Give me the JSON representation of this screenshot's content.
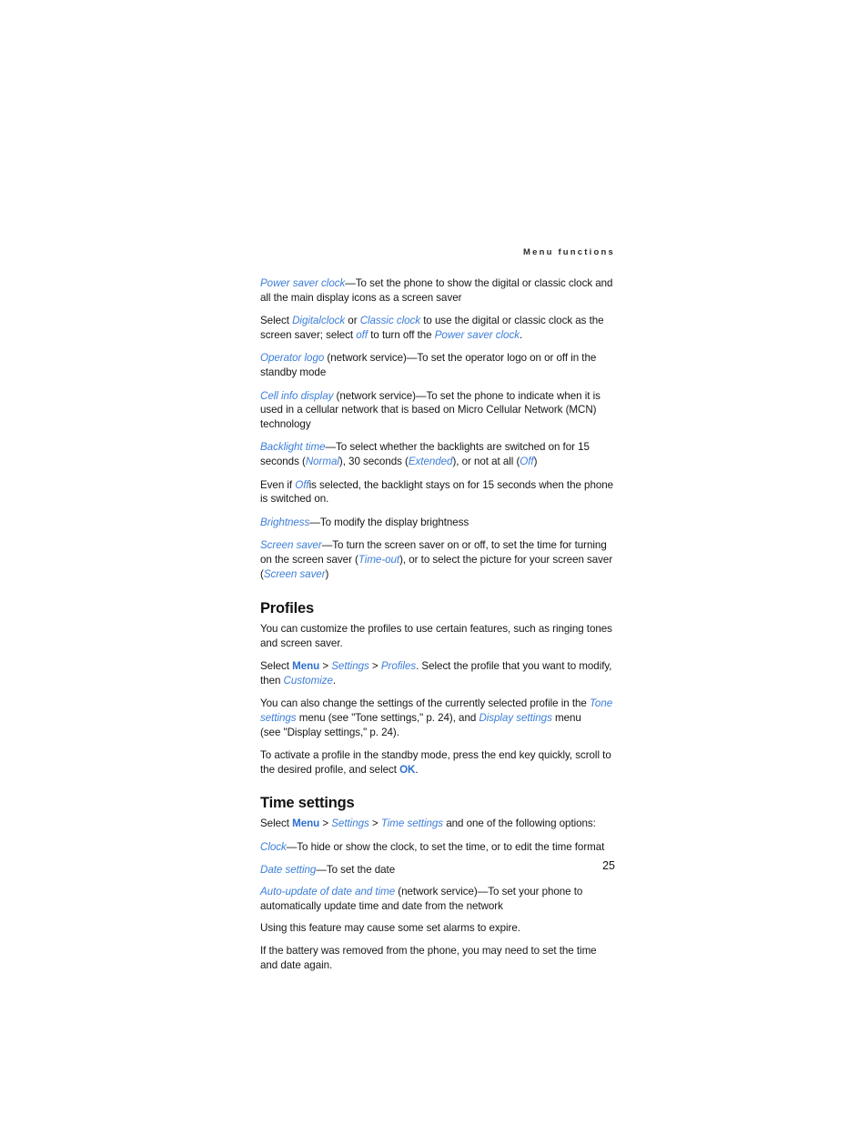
{
  "header": {
    "running_head": "Menu functions"
  },
  "page": {
    "number": "25"
  },
  "body": {
    "p1": {
      "term": "Power saver clock",
      "text": "—To set the phone to show the digital or classic clock and all the main display icons as a screen saver"
    },
    "p2": {
      "lead": "Select ",
      "term1": "Digitalclock",
      "mid1": " or ",
      "term2": "Classic clock",
      "mid2": " to use the digital or classic clock as the screen saver; select ",
      "term3": "off",
      "mid3": " to turn off the ",
      "term4": "Power saver clock",
      "tail": "."
    },
    "p3": {
      "term": "Operator logo",
      "text": " (network service)—To set the operator logo on or off in the standby mode"
    },
    "p4": {
      "term": "Cell info display",
      "text": " (network service)—To set the phone to indicate when it is used in a cellular network that is based on Micro Cellular Network (MCN) technology"
    },
    "p5": {
      "term": "Backlight time",
      "mid1": "—To select whether the backlights are switched on for 15 seconds (",
      "term2": "Normal",
      "mid2": "), 30 seconds (",
      "term3": "Extended",
      "mid3": "), or not at all (",
      "term4": "Off",
      "tail": ")"
    },
    "p6": {
      "lead": "Even if ",
      "term": "Off",
      "text": "is selected, the backlight stays on for 15 seconds when the phone is switched on."
    },
    "p7": {
      "term": "Brightness",
      "text": "—To modify the display brightness"
    },
    "p8": {
      "term": "Screen saver",
      "mid1": "—To turn the screen saver on or off, to set the time for turning on the screen saver (",
      "term2": "Time-out",
      "mid2": "), or to select the picture for your screen saver (",
      "term3": "Screen saver",
      "tail": ")"
    }
  },
  "profiles": {
    "heading": "Profiles",
    "p1": "You can customize the profiles to use certain features, such as ringing tones and screen saver.",
    "p2": {
      "lead": "Select ",
      "menu": "Menu",
      "sep1": " > ",
      "settings": "Settings",
      "sep2": " > ",
      "profiles": "Profiles",
      "mid": ". Select the profile that you want to modify, then ",
      "customize": "Customize",
      "tail": "."
    },
    "p3": {
      "lead": "You can also change the settings of the currently selected profile in the ",
      "tone_settings": "Tone settings",
      "mid1": " menu (see \"Tone settings,\" p. 24), and ",
      "display_settings": "Display settings",
      "mid2": " menu",
      "line3": "(see \"Display settings,\" p. 24)."
    },
    "p4": {
      "lead": "To activate a profile in the standby mode, press the end key quickly, scroll to the desired profile, and select ",
      "ok": "OK",
      "tail": "."
    }
  },
  "time_settings": {
    "heading": "Time settings",
    "p1": {
      "lead": "Select ",
      "menu": "Menu",
      "sep1": " > ",
      "settings": "Settings",
      "sep2": " > ",
      "time_settings": "Time settings",
      "tail": " and one of the following options:"
    },
    "p2": {
      "term": "Clock",
      "text": "—To hide or show the clock, to set the time, or to edit the time format"
    },
    "p3": {
      "term": "Date setting",
      "text": "—To set the date"
    },
    "p4": {
      "term": "Auto-update of date and time",
      "text": " (network service)—To set your phone to automatically update time and date from the network"
    },
    "p5": "Using this feature may cause some set alarms to expire.",
    "p6": "If the battery was removed from the phone, you may need to set the time and date again."
  },
  "colors": {
    "link_blue": "#3c7ed9",
    "bold_blue": "#2d6fd1",
    "body_text": "#161616"
  }
}
